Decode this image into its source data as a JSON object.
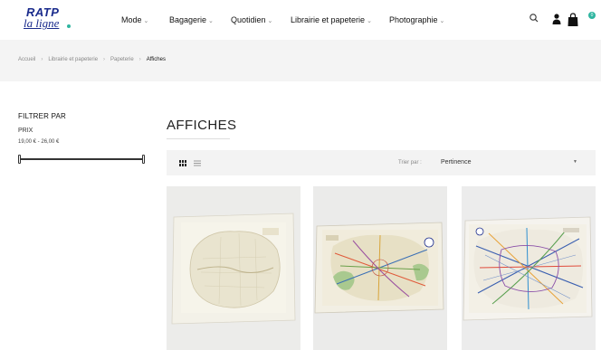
{
  "header": {
    "logo": {
      "line1": "RATP",
      "line2": "la ligne"
    },
    "nav": [
      {
        "label": "Mode"
      },
      {
        "label": "Bagagerie"
      },
      {
        "label": "Quotidien"
      },
      {
        "label": "Librairie et papeterie"
      },
      {
        "label": "Photographie"
      }
    ],
    "cart_count": "0"
  },
  "breadcrumb": {
    "items": [
      "Accueil",
      "Librairie et papeterie",
      "Papeterie"
    ],
    "current": "Affiches"
  },
  "sidebar": {
    "filter_title": "FILTRER PAR",
    "price_label": "PRIX",
    "price_range": "19,00 € - 26,00 €",
    "slider": {
      "min_fraction": 0.0,
      "max_fraction": 1.0
    }
  },
  "main": {
    "title": "AFFICHES",
    "sort_label": "Trier par :",
    "sort_value": "Pertinence"
  },
  "colors": {
    "brand": "#1a2b8c",
    "accent": "#2fb5a0"
  },
  "products": [
    {
      "image": "vintage-paris-street-map-poster"
    },
    {
      "image": "colored-paris-metro-map-poster"
    },
    {
      "image": "paris-metro-network-map-poster"
    }
  ]
}
